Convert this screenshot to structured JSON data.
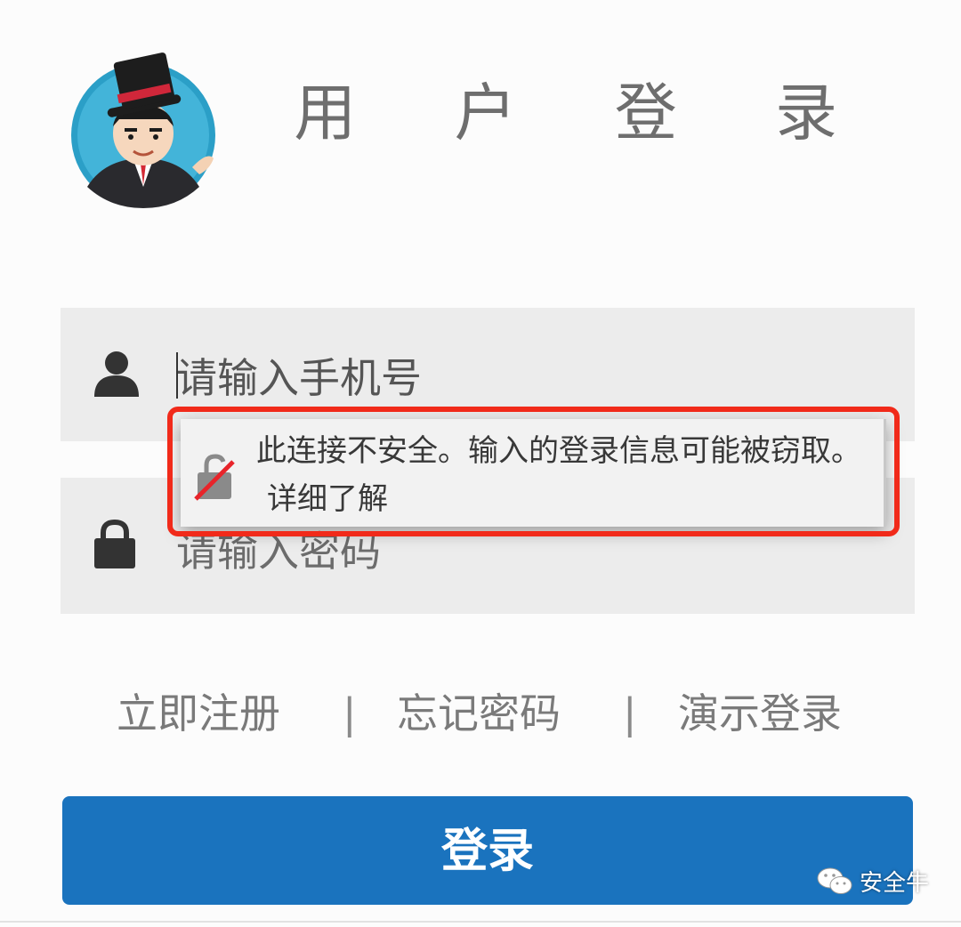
{
  "header": {
    "title": "用 户 登 录"
  },
  "form": {
    "phone_placeholder": "请输入手机号",
    "password_placeholder": "请输入密码"
  },
  "security_warning": {
    "message": "此连接不安全。输入的登录信息可能被窃取。",
    "learn_more": "详细了解"
  },
  "links": {
    "register": "立即注册",
    "forgot_password": "忘记密码",
    "demo_login": "演示登录",
    "separator": "|"
  },
  "login_button": {
    "label": "登录"
  },
  "watermark": {
    "text": "安全牛"
  },
  "colors": {
    "primary": "#1a73be",
    "highlight": "#f12a1a",
    "field_bg": "#ececec"
  },
  "icons": [
    "user-icon",
    "lock-icon",
    "broken-lock-icon",
    "wechat-icon"
  ]
}
